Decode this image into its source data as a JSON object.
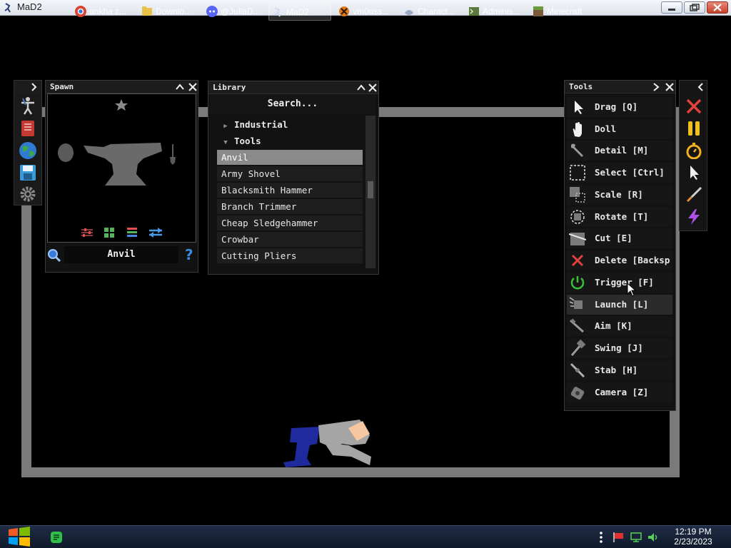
{
  "window": {
    "title": "MaD2"
  },
  "sidebar": {
    "icons": [
      "ragdoll-icon",
      "book-icon",
      "globe-icon",
      "save-icon",
      "settings-gear-icon"
    ]
  },
  "spawn_panel": {
    "title": "Spawn",
    "selected_name": "Anvil",
    "view_tools": [
      "sliders-icon",
      "grid-icon",
      "layers-icon",
      "swap-icon"
    ]
  },
  "library_panel": {
    "title": "Library",
    "search_placeholder": "Search...",
    "categories": [
      {
        "label": "Industrial",
        "expanded": false
      },
      {
        "label": "Tools",
        "expanded": true
      }
    ],
    "items": [
      {
        "label": "Anvil",
        "selected": true
      },
      {
        "label": "Army Shovel",
        "selected": false
      },
      {
        "label": "Blacksmith Hammer",
        "selected": false
      },
      {
        "label": "Branch Trimmer",
        "selected": false
      },
      {
        "label": "Cheap Sledgehammer",
        "selected": false
      },
      {
        "label": "Crowbar",
        "selected": false
      },
      {
        "label": "Cutting Pliers",
        "selected": false
      }
    ]
  },
  "tools_panel": {
    "title": "Tools",
    "items": [
      {
        "label": "Drag [Q]",
        "icon": "cursor-icon",
        "highlight": false
      },
      {
        "label": "Doll",
        "icon": "hand-icon",
        "highlight": false
      },
      {
        "label": "Detail [M]",
        "icon": "wrench-icon",
        "highlight": false
      },
      {
        "label": "Select [Ctrl]",
        "icon": "select-box-icon",
        "highlight": false
      },
      {
        "label": "Scale [R]",
        "icon": "scale-icon",
        "highlight": false
      },
      {
        "label": "Rotate [T]",
        "icon": "rotate-icon",
        "highlight": false
      },
      {
        "label": "Cut [E]",
        "icon": "cut-icon",
        "highlight": false
      },
      {
        "label": "Delete [Backsp",
        "icon": "delete-x-icon",
        "highlight": false
      },
      {
        "label": "Trigger [F]",
        "icon": "power-icon",
        "highlight": false
      },
      {
        "label": "Launch [L]",
        "icon": "launch-icon",
        "highlight": true
      },
      {
        "label": "Aim [K]",
        "icon": "aim-icon",
        "highlight": false
      },
      {
        "label": "Swing [J]",
        "icon": "swing-hammer-icon",
        "highlight": false
      },
      {
        "label": "Stab [H]",
        "icon": "stab-sword-icon",
        "highlight": false
      },
      {
        "label": "Camera [Z]",
        "icon": "camera-icon",
        "highlight": false
      }
    ]
  },
  "quick_bar": {
    "icons": [
      "clear-x-icon",
      "pause-icon",
      "stopwatch-icon",
      "pointer-icon",
      "knife-icon",
      "lightning-icon"
    ]
  },
  "taskbar": {
    "items": [
      {
        "label": "",
        "icon": "start-windows-icon",
        "color": "#e04a2a"
      },
      {
        "label": "",
        "icon": "green-app-icon",
        "color": "#2fbf4a"
      },
      {
        "label": "ankha z...",
        "icon": "chrome-icon",
        "color": "#d9432f",
        "active": false
      },
      {
        "label": "Downlo...",
        "icon": "folder-icon",
        "color": "#e8c14a",
        "active": false
      },
      {
        "label": "@JuliaD...",
        "icon": "discord-icon",
        "color": "#5865f2",
        "active": false
      },
      {
        "label": "MaD2",
        "icon": "mad2-icon",
        "color": "#8aa0c8",
        "active": true
      },
      {
        "label": "vm0uss...",
        "icon": "vm-icon",
        "color": "#e07a1a",
        "active": false
      },
      {
        "label": "Charact...",
        "icon": "discord-char-icon",
        "color": "#7a8aa8",
        "active": false
      },
      {
        "label": "Adminis...",
        "icon": "terminal-icon",
        "color": "#5a7a3a",
        "active": false
      },
      {
        "label": "Minecraft",
        "icon": "minecraft-icon",
        "color": "#6a9a3a",
        "active": false
      }
    ],
    "clock_time": "12:19 PM",
    "clock_date": "2/23/2023"
  }
}
